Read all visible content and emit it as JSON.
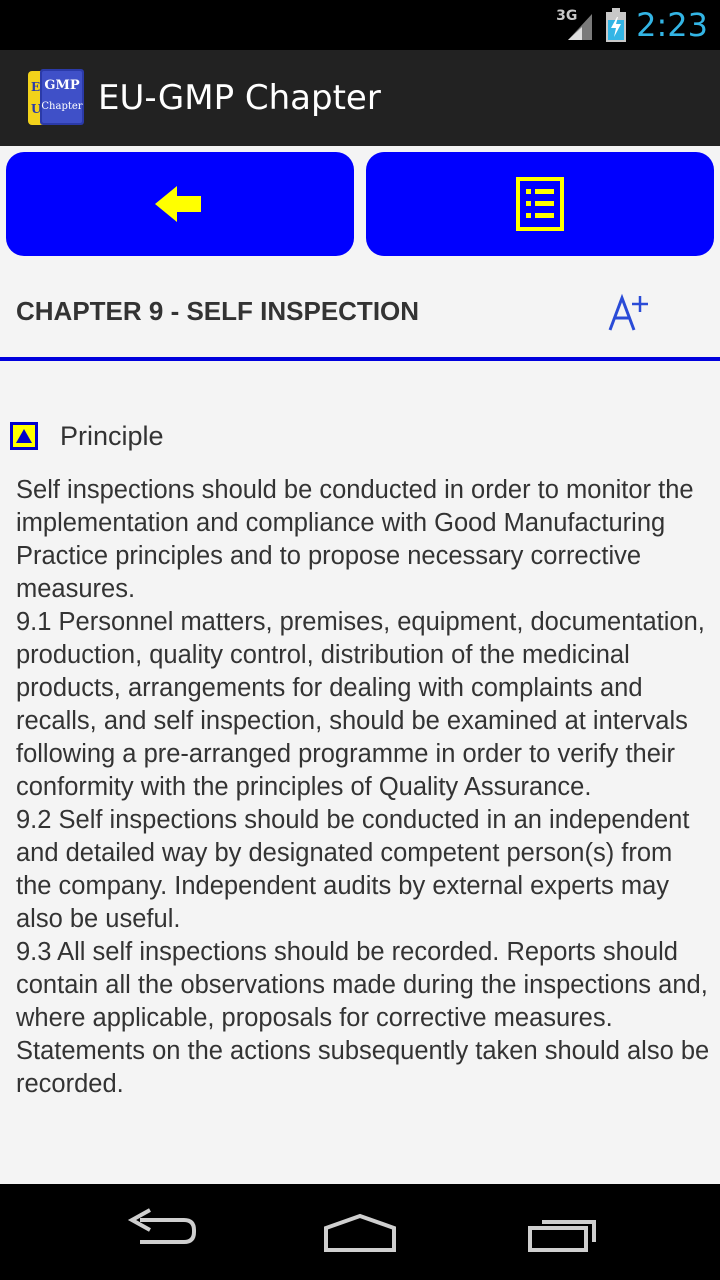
{
  "status_bar": {
    "network_type": "3G",
    "time": "2:23",
    "icons": [
      "signal-icon",
      "battery-charging-icon"
    ]
  },
  "action_bar": {
    "title": "EU-GMP Chapter",
    "app_icon_text_top": "GMP",
    "app_icon_text_bottom": "Chapter",
    "app_icon_side": "EU"
  },
  "buttons": {
    "back_icon": "arrow-left-icon",
    "list_icon": "list-icon",
    "color_bg": "#0000ff",
    "color_icon": "#ffff00"
  },
  "chapter": {
    "title": "CHAPTER 9 - SELF INSPECTION",
    "font_size_icon": "font-size-increase-icon"
  },
  "section": {
    "title": "Principle",
    "toggle_icon": "collapse-up-icon"
  },
  "content": {
    "paragraphs": [
      "Self inspections should be conducted in order to monitor the implementation and compliance with Good Manufacturing Practice principles and to propose necessary corrective measures.",
      "9.1 Personnel matters, premises, equipment, documentation, production, quality control, distribution of the medicinal products, arrangements for dealing with complaints and recalls, and self inspection, should be examined at intervals following a pre-arranged programme in order to verify their conformity with the principles of Quality Assurance.",
      "9.2 Self inspections should be conducted in an independent and detailed way by designated competent person(s) from the company. Independent audits by external experts may also be useful.",
      "9.3 All self inspections should be recorded. Reports should contain all the observations made during the inspections and, where applicable, proposals for corrective measures. Statements on the actions subsequently taken should also be recorded."
    ]
  },
  "nav_bar": {
    "icons": [
      "back-nav-icon",
      "home-nav-icon",
      "recents-nav-icon"
    ]
  }
}
